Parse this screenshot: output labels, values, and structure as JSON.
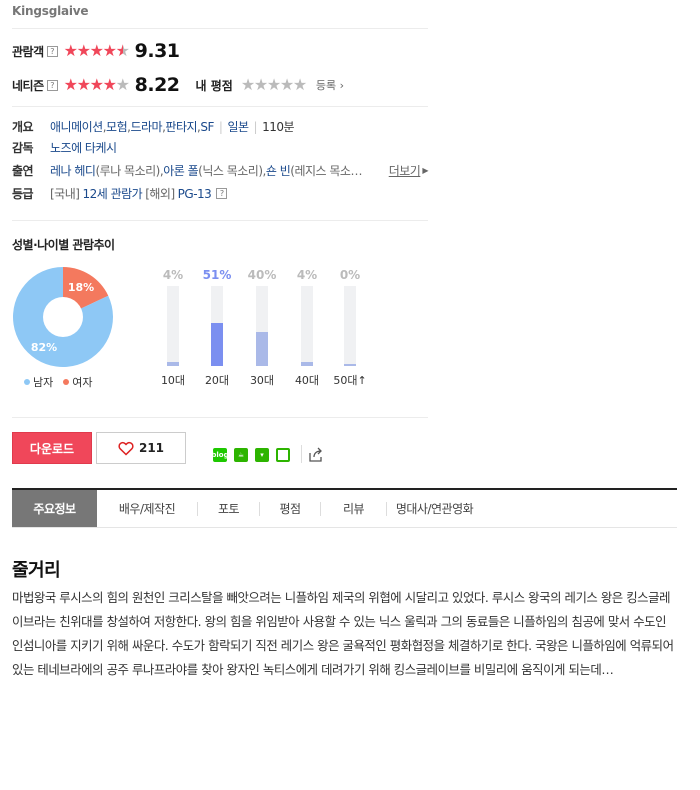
{
  "subtitle": "Kingsglaive",
  "ratings": {
    "audience": {
      "label": "관람객",
      "help": "?",
      "score": "9.31",
      "stars": 4.65
    },
    "netizen": {
      "label": "네티즌",
      "help": "?",
      "score": "8.22",
      "stars": 4.1
    },
    "my": {
      "label": "내 평점",
      "register": "등록",
      "stars": 0
    }
  },
  "info": {
    "overview": {
      "key": "개요",
      "genres": [
        "애니메이션",
        "모험",
        "드라마",
        "판타지",
        "SF"
      ],
      "country": "일본",
      "runtime": "110분"
    },
    "director": {
      "key": "감독",
      "name": "노즈에 타케시"
    },
    "cast": {
      "key": "출연",
      "members": [
        {
          "name": "레나 헤디",
          "role": "(루나 목소리)"
        },
        {
          "name": "아론 폴",
          "role": "(닉스 목소리)"
        },
        {
          "name": "숀 빈",
          "role": "(레지스 목소…"
        }
      ],
      "more": "더보기"
    },
    "grade": {
      "key": "등급",
      "domestic_prefix": "[국내]",
      "domestic": "12세 관람가",
      "overseas_prefix": "[해외]",
      "overseas": "PG-13",
      "help": "?"
    }
  },
  "demographics": {
    "title": "성별·나이별 관람추이",
    "gender": {
      "male_pct": 82,
      "female_pct": 18,
      "male_label": "82%",
      "female_label": "18%",
      "male_legend": "남자",
      "female_legend": "여자",
      "male_color": "#8ec8f5",
      "female_color": "#f4795e"
    },
    "age": [
      {
        "label": "10대",
        "pct_text": "4%",
        "value": 4
      },
      {
        "label": "20대",
        "pct_text": "51%",
        "value": 51,
        "highlight": true
      },
      {
        "label": "30대",
        "pct_text": "40%",
        "value": 40
      },
      {
        "label": "40대",
        "pct_text": "4%",
        "value": 4
      },
      {
        "label": "50대↑",
        "pct_text": "0%",
        "value": 0
      }
    ]
  },
  "actions": {
    "download": "다운로드",
    "like_count": "211"
  },
  "tabs": [
    "주요정보",
    "배우/제작진",
    "포토",
    "평점",
    "리뷰",
    "명대사/연관영화"
  ],
  "synopsis": {
    "title": "줄거리",
    "text": "마법왕국 루시스의 힘의 원천인 크리스탈을 빼앗으려는 니플하임 제국의 위협에 시달리고 있었다. 루시스 왕국의 레기스 왕은 킹스글레이브라는 친위대를 창설하여 저항한다. 왕의 힘을 위임받아 사용할 수 있는 닉스 울릭과 그의 동료들은 니플하임의 침공에 맞서 수도인 인섬니아를 지키기 위해 싸운다. 수도가 함락되기 직전 레기스 왕은 굴욕적인 평화협정을 체결하기로 한다. 국왕은 니플하임에 억류되어 있는 테네브라에의 공주 루나프라야를 찾아 왕자인 녹티스에게 데려가기 위해 킹스글레이브를 비밀리에 움직이게 되는데…"
  },
  "colors": {
    "accent": "#f0475a",
    "link": "#1b4a8c",
    "age_fill": "#aab9e8",
    "age_fill_highlight": "#7b8ff0"
  }
}
